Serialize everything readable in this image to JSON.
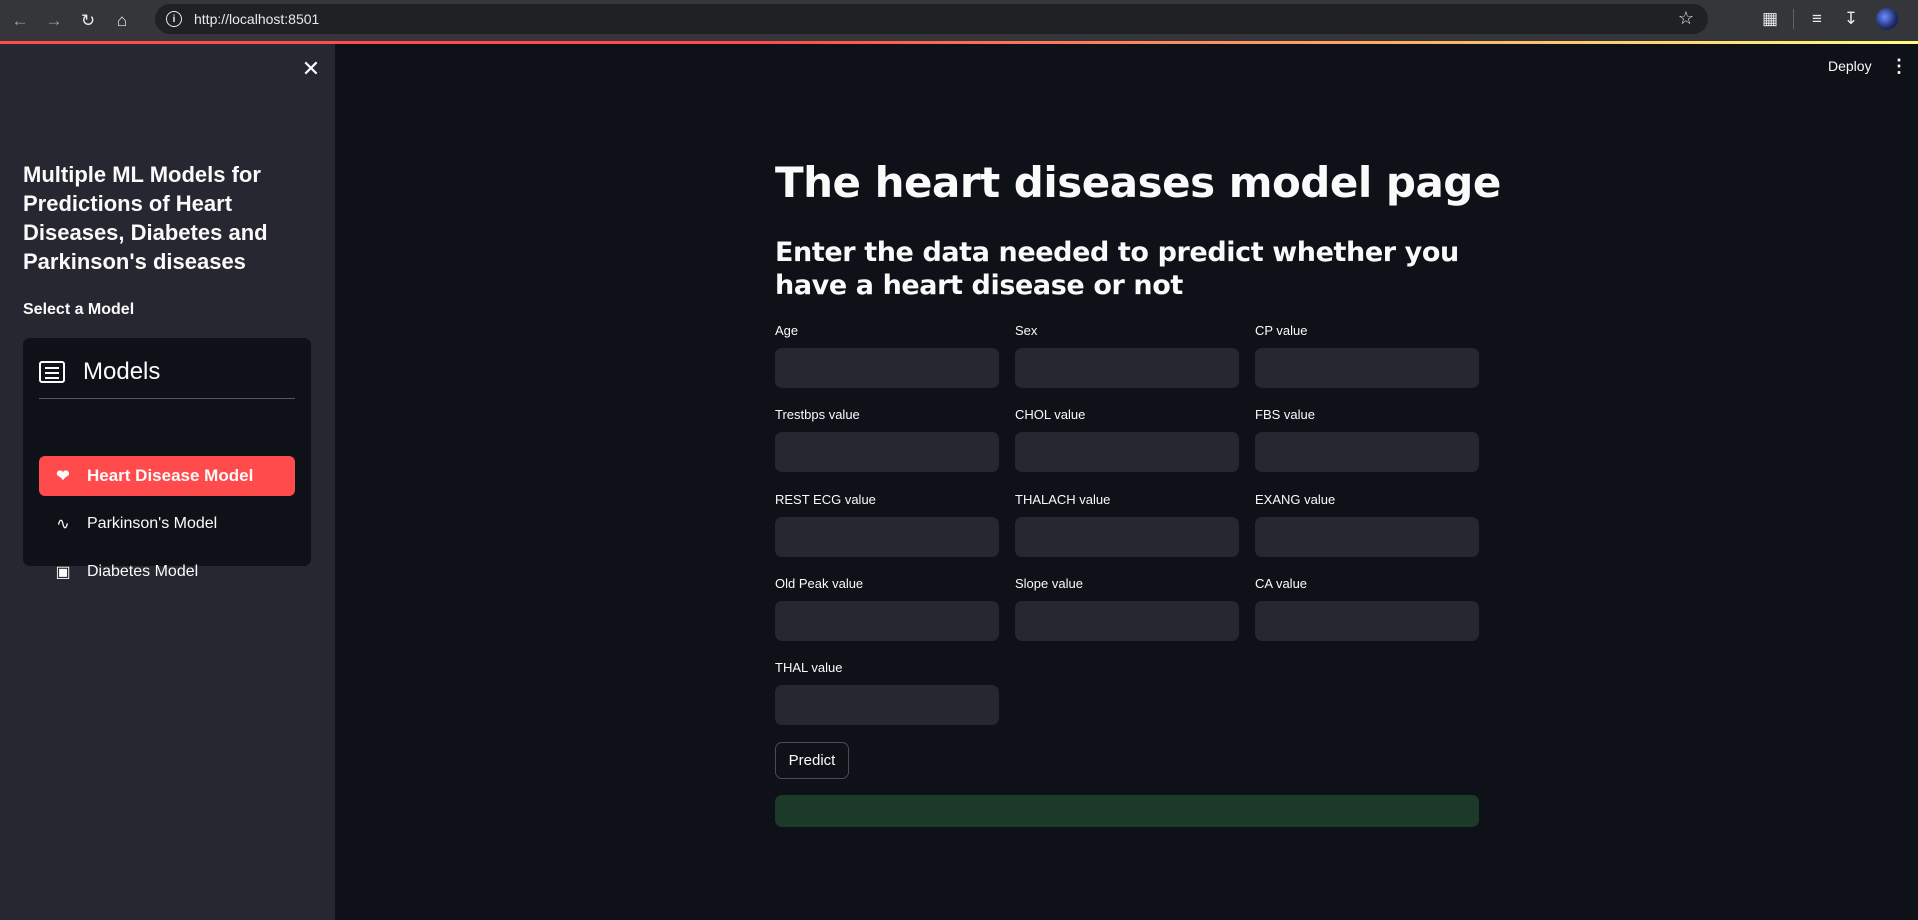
{
  "browser": {
    "url": "http://localhost:8501"
  },
  "sidebar": {
    "title": "Multiple ML Models for Predictions of Heart Diseases, Diabetes and Parkinson's diseases",
    "select_label": "Select a Model",
    "menu_title": "Models",
    "items": [
      {
        "label": "Heart Disease Model",
        "icon": "heart-pulse-icon",
        "active": true
      },
      {
        "label": "Parkinson's Model",
        "icon": "activity-icon",
        "active": false
      },
      {
        "label": "Diabetes Model",
        "icon": "hospital-icon",
        "active": false
      }
    ]
  },
  "header": {
    "deploy_label": "Deploy"
  },
  "main": {
    "title": "The heart diseases model page",
    "subtitle": "Enter the data needed to predict whether you have a heart disease or not",
    "fields": [
      {
        "label": "Age",
        "value": ""
      },
      {
        "label": "Sex",
        "value": ""
      },
      {
        "label": "CP value",
        "value": ""
      },
      {
        "label": "Trestbps value",
        "value": ""
      },
      {
        "label": "CHOL value",
        "value": ""
      },
      {
        "label": "FBS value",
        "value": ""
      },
      {
        "label": "REST ECG value",
        "value": ""
      },
      {
        "label": "THALACH value",
        "value": ""
      },
      {
        "label": "EXANG value",
        "value": ""
      },
      {
        "label": "Old Peak value",
        "value": ""
      },
      {
        "label": "Slope value",
        "value": ""
      },
      {
        "label": "CA value",
        "value": ""
      },
      {
        "label": "THAL value",
        "value": ""
      }
    ],
    "predict_label": "Predict"
  },
  "colors": {
    "accent": "#ff4b4b",
    "background": "#0e1117",
    "sidebar": "#262730",
    "success": "#1b3a2a"
  }
}
